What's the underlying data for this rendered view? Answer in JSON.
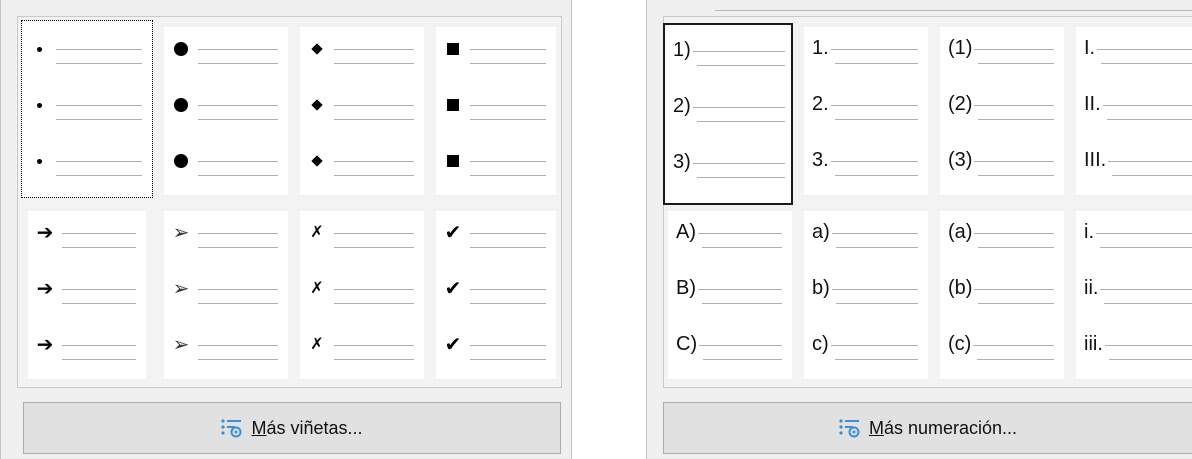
{
  "bullets_panel": {
    "rows": [
      [
        {
          "id": "small-dot",
          "count": 3
        },
        {
          "id": "big-dot",
          "count": 3
        },
        {
          "id": "diamond",
          "count": 3
        },
        {
          "id": "square",
          "count": 3
        }
      ],
      [
        {
          "id": "arrow",
          "glyph": "➔",
          "count": 3
        },
        {
          "id": "pointer",
          "glyph": "➢",
          "count": 3
        },
        {
          "id": "x-mark",
          "glyph": "✗",
          "count": 3
        },
        {
          "id": "check",
          "glyph": "✔",
          "count": 3
        }
      ]
    ],
    "more_button": {
      "accel": "M",
      "rest": "ás viñetas..."
    }
  },
  "numbering_panel": {
    "rows": [
      [
        [
          "1)",
          "2)",
          "3)"
        ],
        [
          "1.",
          "2.",
          "3."
        ],
        [
          "(1)",
          "(2)",
          "(3)"
        ],
        [
          "I.",
          "II.",
          "III."
        ]
      ],
      [
        [
          "A)",
          "B)",
          "C)"
        ],
        [
          "a)",
          "b)",
          "c)"
        ],
        [
          "(a)",
          "(b)",
          "(c)"
        ],
        [
          "i.",
          "ii.",
          "iii."
        ]
      ]
    ],
    "more_button": {
      "accel": "M",
      "rest": "ás numeración..."
    }
  },
  "colors": {
    "panel_bg": "#f0f0f0",
    "cell_bg": "#ffffff",
    "button_bg": "#e1e1e1",
    "icon_blue": "#3a8fd8"
  }
}
